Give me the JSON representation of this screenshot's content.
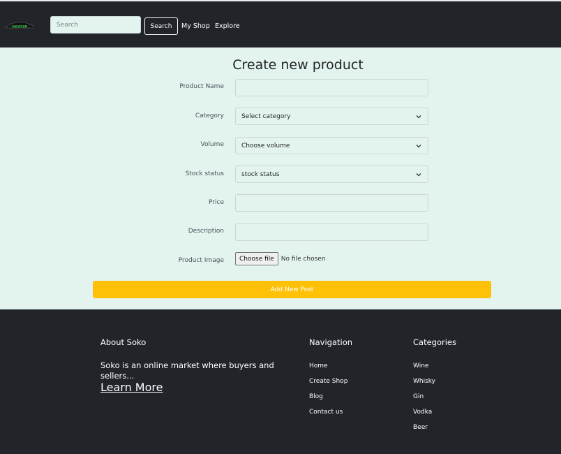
{
  "navbar": {
    "logo": "logo",
    "search_placeholder": "Search",
    "search_button": "Search",
    "links": [
      "My Shop",
      "Explore"
    ]
  },
  "form": {
    "title": "Create new product",
    "fields": {
      "product_name": {
        "label": "Product Name",
        "value": ""
      },
      "category": {
        "label": "Category",
        "selected": "Select category"
      },
      "volume": {
        "label": "Volume",
        "selected": "Choose volume"
      },
      "stock_status": {
        "label": "Stock status",
        "selected": "stock status"
      },
      "price": {
        "label": "Price",
        "value": ""
      },
      "description": {
        "label": "Description",
        "value": ""
      },
      "product_image": {
        "label": "Product Image",
        "button": "Choose file",
        "status": "No file chosen"
      }
    },
    "submit_label": "Add New Post"
  },
  "footer": {
    "about": {
      "heading": "About Soko",
      "text": "Soko is an online market where buyers and sellers...",
      "link": "Learn More"
    },
    "navigation": {
      "heading": "Navigation",
      "items": [
        "Home",
        "Create Shop",
        "Blog",
        "Contact us"
      ]
    },
    "categories": {
      "heading": "Categories",
      "items": [
        "Wine",
        "Whisky",
        "Gin",
        "Vodka",
        "Beer"
      ]
    }
  },
  "colors": {
    "navbar_bg": "#212529",
    "main_bg": "#e3f4ef",
    "accent": "#ffc107",
    "logo_green": "#2ecc40"
  },
  "icons": [
    "car-logo-icon",
    "chevron-down-icon"
  ]
}
